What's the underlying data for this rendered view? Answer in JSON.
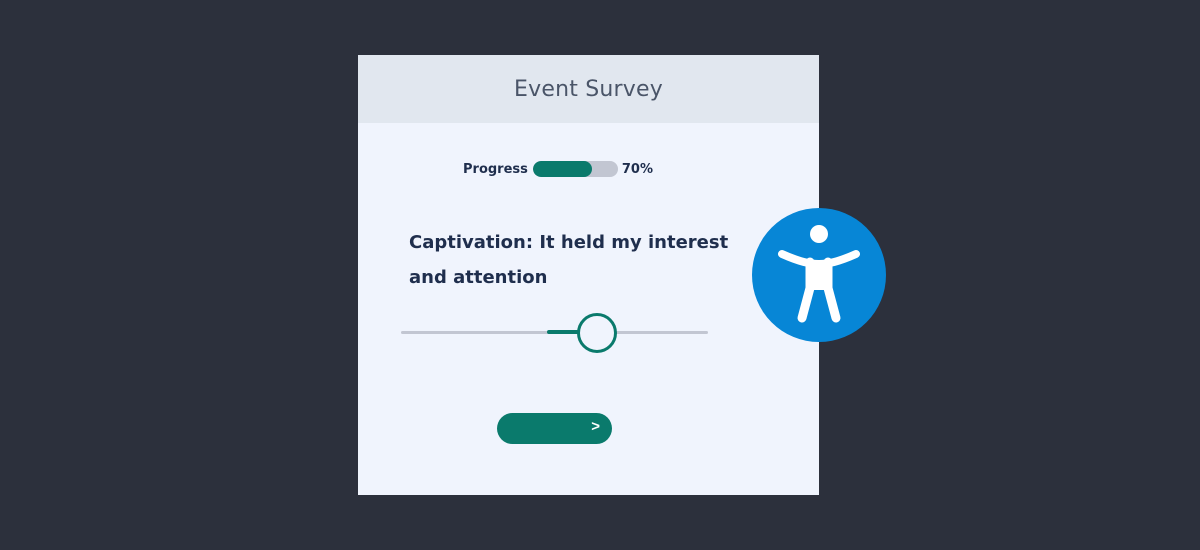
{
  "survey": {
    "title": "Event Survey",
    "progress": {
      "label": "Progress",
      "value_text": "70%",
      "percent": 70
    },
    "question": "Captivation: It held my interest and attention",
    "slider": {
      "fraction": 0.64
    },
    "next_button": {
      "label": ">"
    }
  },
  "accessibility_badge": {
    "icon": "accessibility-person-icon"
  },
  "colors": {
    "background": "#2c303c",
    "card": "#f0f4fd",
    "header": "#e1e7ef",
    "accent": "#0a7a6c",
    "track": "#c2c6d2",
    "badge": "#0786d6",
    "text": "#1f2e4d"
  }
}
